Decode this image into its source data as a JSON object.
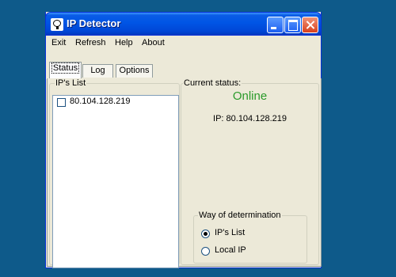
{
  "window": {
    "title": "IP Detector",
    "accent": "#0055e5"
  },
  "menu": [
    "Exit",
    "Refresh",
    "Help",
    "About"
  ],
  "tabs": [
    {
      "label": "Status",
      "selected": true
    },
    {
      "label": "Log",
      "selected": false
    },
    {
      "label": "Options",
      "selected": false
    }
  ],
  "ip_list": {
    "title": "IP's List",
    "items": [
      {
        "ip": "80.104.128.219",
        "checked": false
      }
    ]
  },
  "current_status": {
    "title": "Current status:",
    "state": "Online",
    "state_color": "#2a9a2a",
    "ip_line": "IP: 80.104.128.219"
  },
  "determination": {
    "title": "Way of determination",
    "options": [
      {
        "label": "IP's List",
        "selected": true
      },
      {
        "label": "Local IP",
        "selected": false
      }
    ]
  }
}
